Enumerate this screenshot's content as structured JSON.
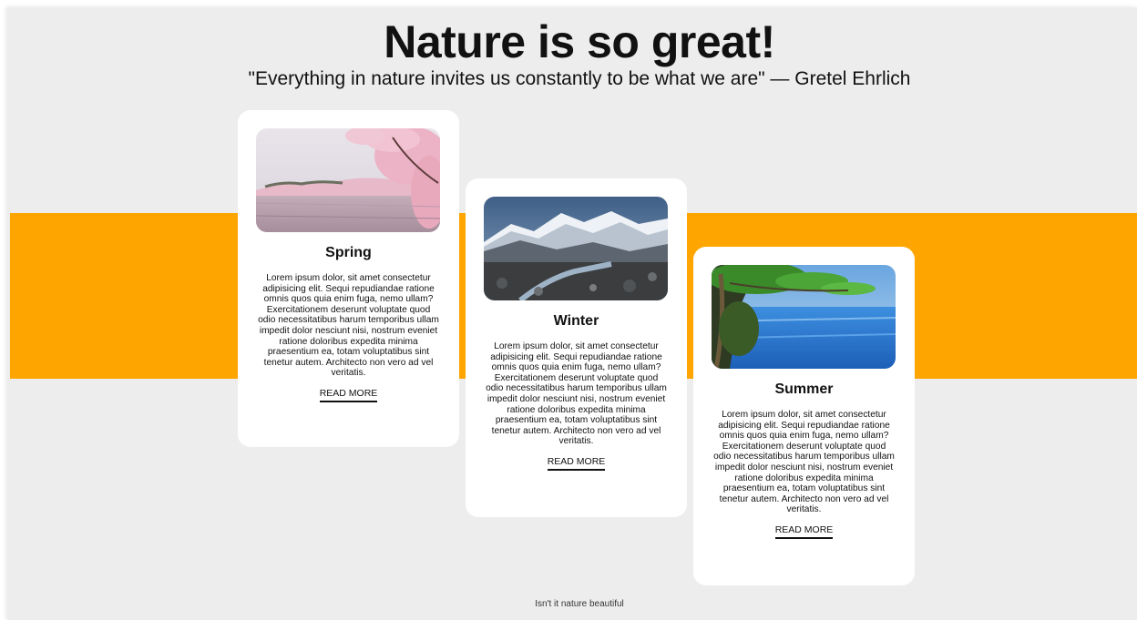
{
  "header": {
    "title": "Nature is so great!",
    "quote": "\"Everything in nature invites us constantly to be what we are\" — Gretel Ehrlich"
  },
  "cards": [
    {
      "title": "Spring",
      "text": "Lorem ipsum dolor, sit amet consectetur adipisicing elit. Sequi repudiandae ratione omnis quos quia enim fuga, nemo ullam? Exercitationem deserunt voluptate quod odio necessitatibus harum temporibus ullam impedit dolor nesciunt nisi, nostrum eveniet ratione doloribus expedita minima praesentium ea, totam voluptatibus sint tenetur autem. Architecto non vero ad vel veritatis.",
      "link": "READ MORE"
    },
    {
      "title": "Winter",
      "text": "Lorem ipsum dolor, sit amet consectetur adipisicing elit. Sequi repudiandae ratione omnis quos quia enim fuga, nemo ullam? Exercitationem deserunt voluptate quod odio necessitatibus harum temporibus ullam impedit dolor nesciunt nisi, nostrum eveniet ratione doloribus expedita minima praesentium ea, totam voluptatibus sint tenetur autem. Architecto non vero ad vel veritatis.",
      "link": "READ MORE"
    },
    {
      "title": "Summer",
      "text": "Lorem ipsum dolor, sit amet consectetur adipisicing elit. Sequi repudiandae ratione omnis quos quia enim fuga, nemo ullam? Exercitationem deserunt voluptate quod odio necessitatibus harum temporibus ullam impedit dolor nesciunt nisi, nostrum eveniet ratione doloribus expedita minima praesentium ea, totam voluptatibus sint tenetur autem. Architecto non vero ad vel veritatis.",
      "link": "READ MORE"
    }
  ],
  "footer": {
    "text": "Isn't it nature beautiful"
  },
  "colors": {
    "band": "#ffa500",
    "background": "#ededed",
    "card": "#ffffff"
  }
}
